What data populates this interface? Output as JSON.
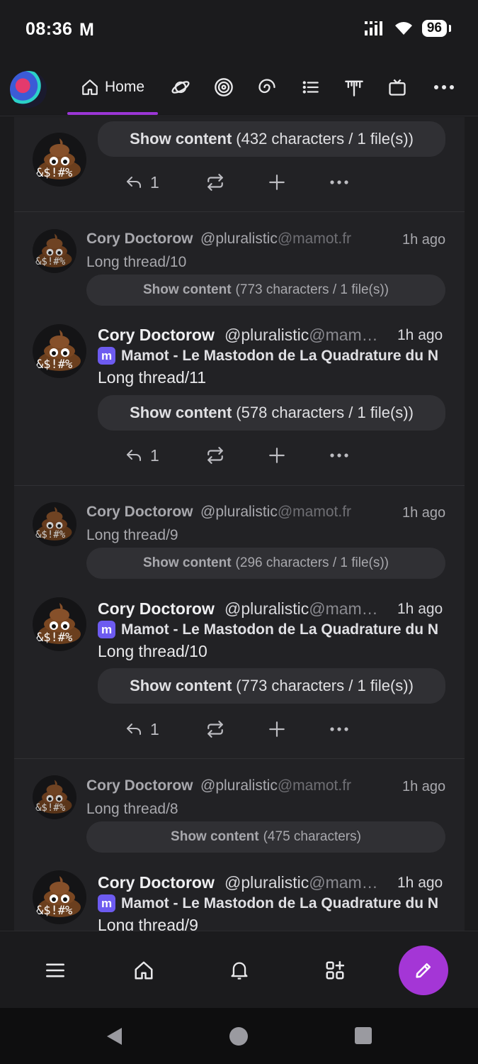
{
  "status_bar": {
    "time": "08:36",
    "notif_letter": "M",
    "battery": "96"
  },
  "nav": {
    "home_label": "Home",
    "icons": [
      "planet-icon",
      "target-icon",
      "spiral-icon",
      "list-icon",
      "antenna-icon",
      "tv-icon",
      "more-icon"
    ]
  },
  "posts": [
    {
      "type": "main",
      "show_label": "Show content",
      "show_detail": "(432 characters / 1 file(s))",
      "reply_count": "1"
    },
    {
      "type": "context",
      "name": "Cory Doctorow",
      "handle": "@pluralistic",
      "domain": "@mamot.fr",
      "time": "1h ago",
      "text": "Long thread/10",
      "show_label": "Show content",
      "show_detail": "(773 characters / 1 file(s))"
    },
    {
      "type": "main",
      "name": "Cory Doctorow",
      "handle": "@pluralistic",
      "domain": "@mam…",
      "time": "1h ago",
      "instance": "Mamot - Le Mastodon de La Quadrature du N",
      "text": "Long thread/11",
      "show_label": "Show content",
      "show_detail": "(578 characters / 1 file(s))",
      "reply_count": "1"
    },
    {
      "type": "context",
      "name": "Cory Doctorow",
      "handle": "@pluralistic",
      "domain": "@mamot.fr",
      "time": "1h ago",
      "text": "Long thread/9",
      "show_label": "Show content",
      "show_detail": "(296 characters / 1 file(s))"
    },
    {
      "type": "main",
      "name": "Cory Doctorow",
      "handle": "@pluralistic",
      "domain": "@mam…",
      "time": "1h ago",
      "instance": "Mamot - Le Mastodon de La Quadrature du N",
      "text": "Long thread/10",
      "show_label": "Show content",
      "show_detail": "(773 characters / 1 file(s))",
      "reply_count": "1"
    },
    {
      "type": "context",
      "name": "Cory Doctorow",
      "handle": "@pluralistic",
      "domain": "@mamot.fr",
      "time": "1h ago",
      "text": "Long thread/8",
      "show_label": "Show content",
      "show_detail": "(475 characters)"
    },
    {
      "type": "main",
      "name": "Cory Doctorow",
      "handle": "@pluralistic",
      "domain": "@mam…",
      "time": "1h ago",
      "instance": "Mamot - Le Mastodon de La Quadrature du N",
      "text": "Long thread/9"
    }
  ],
  "avatar_text": "&$!#%",
  "instance_badge": "m",
  "bottom_bar": {
    "icons": [
      "menu-icon",
      "home-icon",
      "bell-icon",
      "apps-add-icon"
    ],
    "fab_icon": "pencil-icon"
  },
  "colors": {
    "accent": "#9b36d6",
    "fab": "#a436d6",
    "mastodon": "#6d5bf0"
  }
}
